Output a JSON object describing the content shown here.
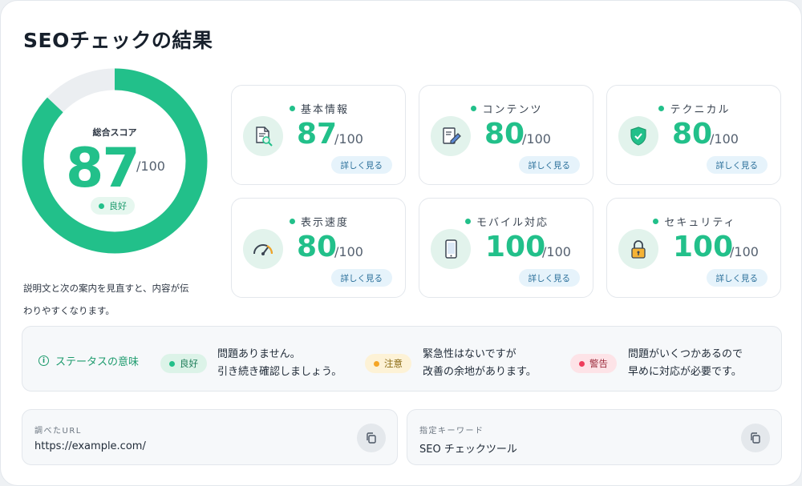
{
  "header": {
    "title": "SEOチェックの結果"
  },
  "overall": {
    "label": "総合スコア",
    "score": "87",
    "score_value": 87,
    "max": "/100",
    "status": "良好",
    "ring_color": "#22c08a",
    "track_color": "#ebeef1"
  },
  "explanation": {
    "line1": "説明文と次の案内を見直すと、内容が伝",
    "line2": "わりやすくなります。"
  },
  "metrics": [
    {
      "title": "基本情報",
      "score": "87",
      "max": "/100",
      "link": "詳しく見る",
      "icon": "document-search-icon"
    },
    {
      "title": "コンテンツ",
      "score": "80",
      "max": "/100",
      "link": "詳しく見る",
      "icon": "document-edit-icon"
    },
    {
      "title": "テクニカル",
      "score": "80",
      "max": "/100",
      "link": "詳しく見る",
      "icon": "shield-check-icon"
    },
    {
      "title": "表示速度",
      "score": "80",
      "max": "/100",
      "link": "詳しく見る",
      "icon": "speedometer-icon"
    },
    {
      "title": "モバイル対応",
      "score": "100",
      "max": "/100",
      "link": "詳しく見る",
      "icon": "smartphone-icon"
    },
    {
      "title": "セキュリティ",
      "score": "100",
      "max": "/100",
      "link": "詳しく見る",
      "icon": "lock-icon"
    }
  ],
  "legend": {
    "title": "ステータスの意味",
    "items": [
      {
        "label": "良好",
        "line1": "問題ありません。",
        "line2": "引き続き確認しましょう。",
        "color": "#22c08a"
      },
      {
        "label": "注意",
        "line1": "緊急性はないですが",
        "line2": "改善の余地があります。",
        "color": "#f5a524"
      },
      {
        "label": "警告",
        "line1": "問題がいくつかあるので",
        "line2": "早めに対応が必要です。",
        "color": "#ee3d5c"
      }
    ]
  },
  "url_box": {
    "label": "調べたURL",
    "value": "https://example.com/"
  },
  "keyword_box": {
    "label": "指定キーワード",
    "value": "SEO チェックツール"
  }
}
